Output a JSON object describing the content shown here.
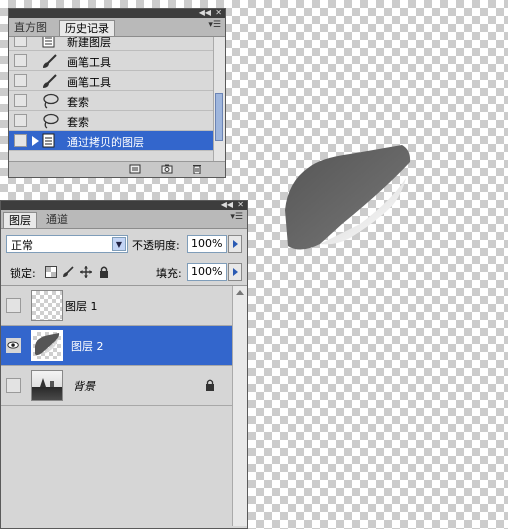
{
  "history_panel": {
    "tabs": [
      "直方图",
      "历史记录"
    ],
    "active_tab": "历史记录",
    "items": [
      {
        "label": "新建图层",
        "icon": "document-icon"
      },
      {
        "label": "画笔工具",
        "icon": "brush-icon"
      },
      {
        "label": "画笔工具",
        "icon": "brush-icon"
      },
      {
        "label": "套索",
        "icon": "lasso-icon"
      },
      {
        "label": "套索",
        "icon": "lasso-icon"
      },
      {
        "label": "通过拷贝的图层",
        "icon": "document-icon",
        "selected": true
      }
    ],
    "footer_buttons": [
      "new-document-from-state-icon",
      "snapshot-camera-icon",
      "trash-icon"
    ]
  },
  "layers_panel": {
    "tabs": [
      "图层",
      "通道"
    ],
    "active_tab": "图层",
    "blend_mode": "正常",
    "opacity_label": "不透明度:",
    "opacity_value": "100%",
    "lock_label": "锁定:",
    "fill_label": "填充:",
    "fill_value": "100%",
    "layers": [
      {
        "name": "图层 1",
        "visible": false,
        "selected": false
      },
      {
        "name": "图层 2",
        "visible": true,
        "selected": true
      },
      {
        "name": "背景",
        "visible": false,
        "selected": false,
        "locked": true
      }
    ]
  },
  "colors": {
    "selection": "#3366cc",
    "panel_bg": "#d6d6d6",
    "panel_bar": "#3d3d3d"
  }
}
